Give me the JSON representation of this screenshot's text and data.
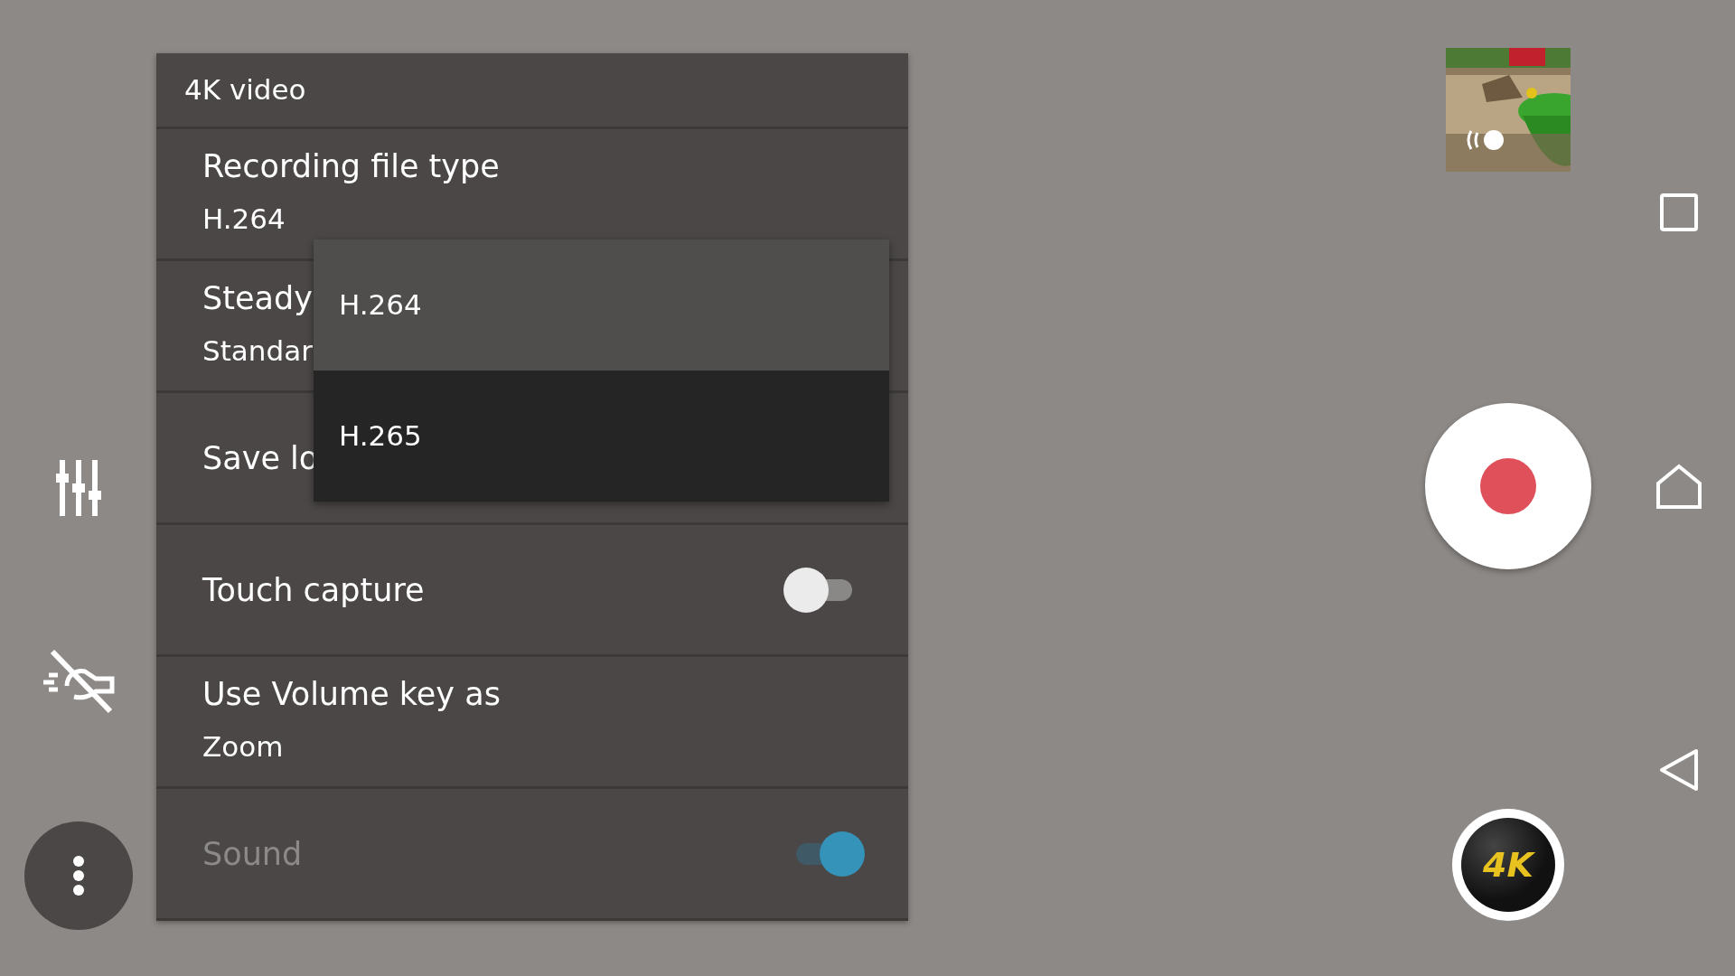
{
  "panel": {
    "title": "4K video",
    "settings": [
      {
        "kind": "value",
        "label": "Recording file type",
        "value": "H.264"
      },
      {
        "kind": "value",
        "label": "Steady",
        "value": "Standar"
      },
      {
        "kind": "plain",
        "label": "Save lo"
      },
      {
        "kind": "toggle",
        "label": "Touch capture",
        "on": false,
        "disabled": false
      },
      {
        "kind": "value",
        "label": "Use Volume key as",
        "value": "Zoom"
      },
      {
        "kind": "toggle",
        "label": "Sound",
        "on": true,
        "disabled": true
      }
    ]
  },
  "dropdown": {
    "options": [
      {
        "label": "H.264",
        "selected": true
      },
      {
        "label": "H.265",
        "selected": false
      }
    ]
  },
  "mode_badge": {
    "label": "4K"
  }
}
